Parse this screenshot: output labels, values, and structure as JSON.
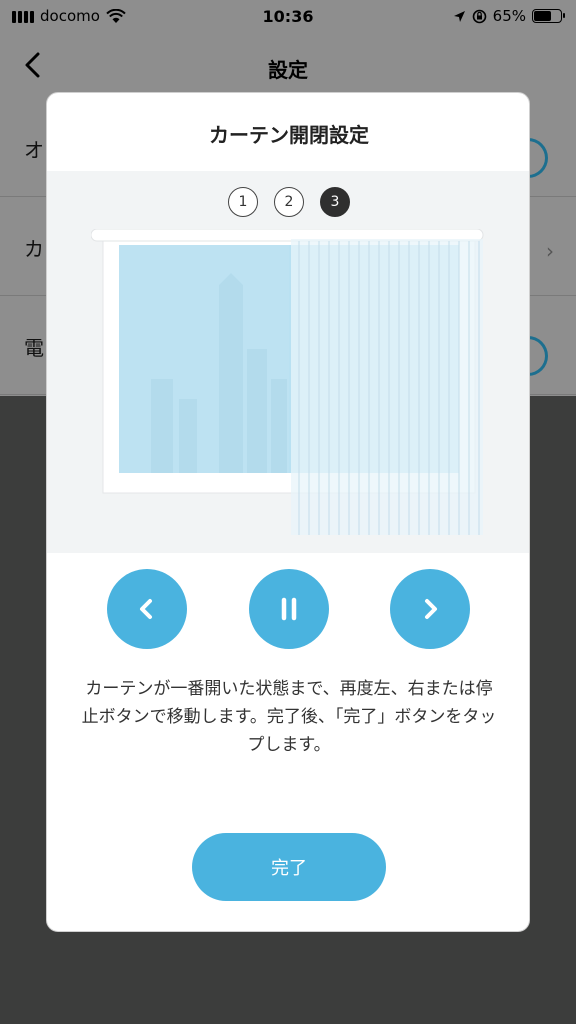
{
  "status_bar": {
    "carrier": "docomo",
    "time": "10:36",
    "battery": "65%",
    "battery_level": 0.65
  },
  "nav": {
    "title": "設定"
  },
  "background_rows": [
    {
      "label": "オ"
    },
    {
      "label": "カ"
    },
    {
      "label": "電"
    }
  ],
  "modal": {
    "title": "カーテン開閉設定",
    "steps": [
      "1",
      "2",
      "3"
    ],
    "current_step": 3,
    "description": "カーテンが一番開いた状態まで、再度左、右または停止ボタンで移動します。完了後、「完了」ボタンをタップします。",
    "done_label": "完了",
    "controls": [
      "chevron-left-icon",
      "pause-icon",
      "chevron-right-icon"
    ]
  },
  "colors": {
    "accent": "#4ab3df",
    "overlay": "#3c3d3c"
  }
}
